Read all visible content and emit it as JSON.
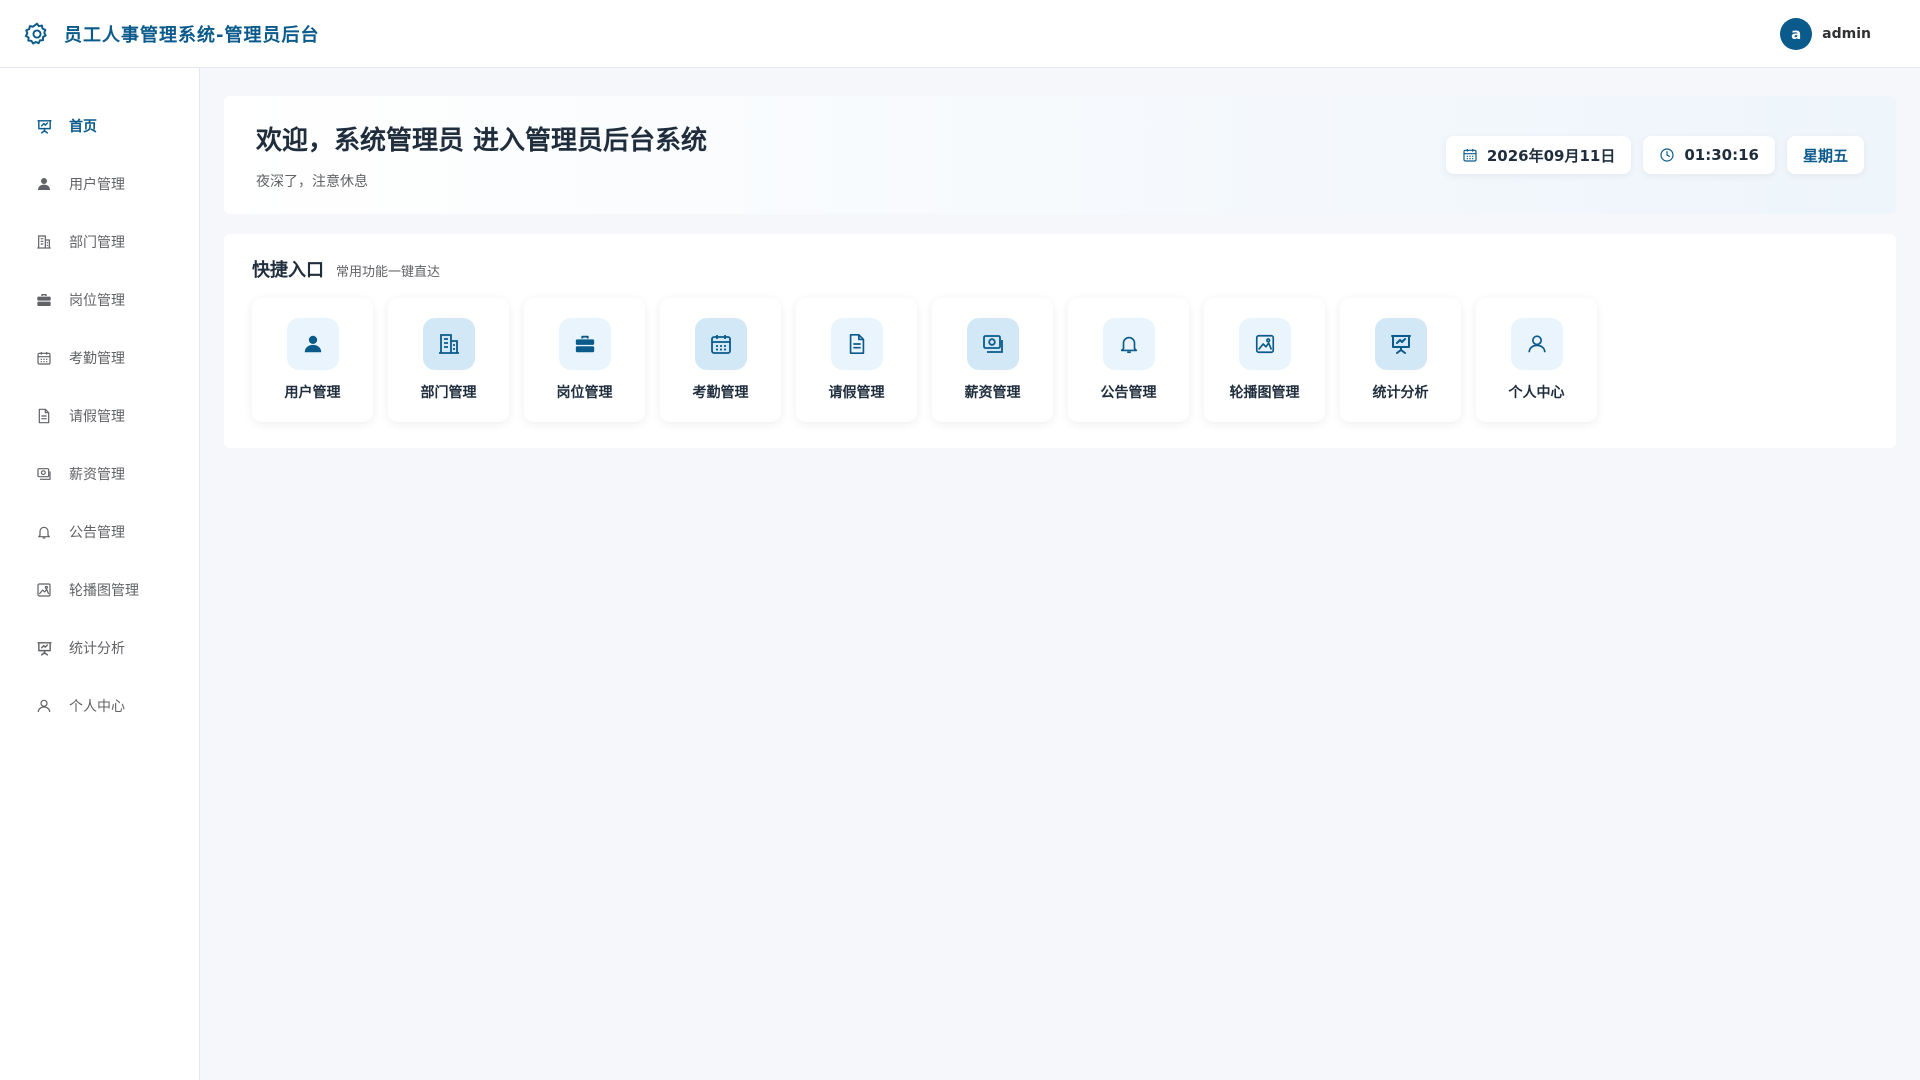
{
  "header": {
    "title": "员工人事管理系统-管理员后台",
    "logo_icon": "gear-icon",
    "avatar_letter": "a",
    "username": "admin"
  },
  "sidebar": {
    "items": [
      {
        "label": "首页",
        "icon": "presentation-chart-icon",
        "active": true
      },
      {
        "label": "用户管理",
        "icon": "user-icon"
      },
      {
        "label": "部门管理",
        "icon": "building-icon"
      },
      {
        "label": "岗位管理",
        "icon": "briefcase-icon"
      },
      {
        "label": "考勤管理",
        "icon": "calendar-icon"
      },
      {
        "label": "请假管理",
        "icon": "document-icon"
      },
      {
        "label": "薪资管理",
        "icon": "money-icon"
      },
      {
        "label": "公告管理",
        "icon": "bell-icon"
      },
      {
        "label": "轮播图管理",
        "icon": "image-icon"
      },
      {
        "label": "统计分析",
        "icon": "presentation-chart-icon"
      },
      {
        "label": "个人中心",
        "icon": "person-outline-icon"
      }
    ]
  },
  "welcome": {
    "heading": "欢迎，系统管理员 进入管理员后台系统",
    "subtext": "夜深了，注意休息",
    "date": "2026年09月11日",
    "time": "01:30:16",
    "weekday": "星期五"
  },
  "quick": {
    "title": "快捷入口",
    "subtitle": "常用功能一键直达",
    "cards": [
      {
        "label": "用户管理",
        "icon": "user-icon"
      },
      {
        "label": "部门管理",
        "icon": "building-icon"
      },
      {
        "label": "岗位管理",
        "icon": "briefcase-icon"
      },
      {
        "label": "考勤管理",
        "icon": "calendar-icon"
      },
      {
        "label": "请假管理",
        "icon": "document-icon"
      },
      {
        "label": "薪资管理",
        "icon": "money-icon"
      },
      {
        "label": "公告管理",
        "icon": "bell-icon"
      },
      {
        "label": "轮播图管理",
        "icon": "image-icon"
      },
      {
        "label": "统计分析",
        "icon": "presentation-chart-icon"
      },
      {
        "label": "个人中心",
        "icon": "person-outline-icon"
      }
    ]
  },
  "colors": {
    "primary": "#0a5a8c",
    "background": "#f5f7fa",
    "icon_tile": "#eaf4fc"
  }
}
